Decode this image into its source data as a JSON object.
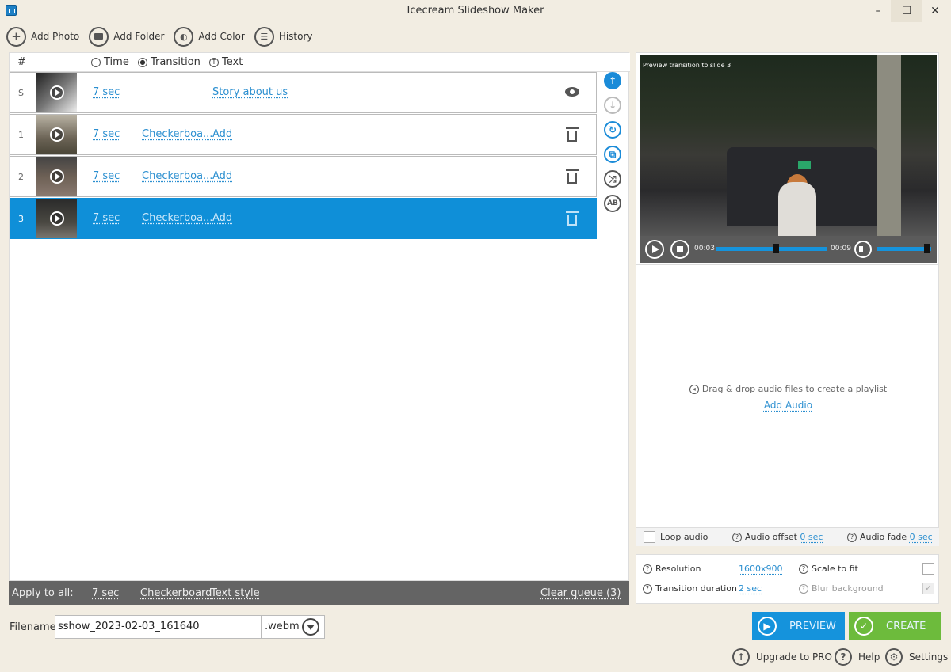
{
  "window": {
    "title": "Icecream Slideshow Maker",
    "minimize": "–",
    "maximize": "☐",
    "close": "✕"
  },
  "toolbar": {
    "add_photo": "Add Photo",
    "add_folder": "Add Folder",
    "add_color": "Add Color",
    "history": "History"
  },
  "list": {
    "headers": {
      "num": "#",
      "time": "Time",
      "transition": "Transition",
      "text": "Text"
    },
    "rows": [
      {
        "num": "S",
        "time": "7 sec",
        "transition": "",
        "text": "Story about us",
        "action_icon": "eye-icon",
        "selected": false
      },
      {
        "num": "1",
        "time": "7 sec",
        "transition": "Checkerboa...",
        "text": "Add",
        "action_icon": "trash-icon",
        "selected": false
      },
      {
        "num": "2",
        "time": "7 sec",
        "transition": "Checkerboa...",
        "text": "Add",
        "action_icon": "trash-icon",
        "selected": false
      },
      {
        "num": "3",
        "time": "7 sec",
        "transition": "Checkerboa...",
        "text": "Add",
        "action_icon": "trash-icon",
        "selected": true
      }
    ]
  },
  "side_actions": [
    "move-up-icon",
    "move-down-icon",
    "rotate-icon",
    "crop-icon",
    "shuffle-icon",
    "text-ab-icon"
  ],
  "apply_all": {
    "label": "Apply to all:",
    "time": "7 sec",
    "transition": "Checkerboard",
    "text_style": "Text style",
    "clear_queue": "Clear queue (3)"
  },
  "filename": {
    "label": "Filename:",
    "value": "sshow_2023-02-03_161640",
    "extension": ".webm"
  },
  "preview": {
    "caption": "Preview transition to slide 3",
    "current_time": "00:03",
    "total_time": "00:09",
    "progress": 0.54,
    "volume": 0.92
  },
  "audio": {
    "drop_text": "Drag & drop audio files to create a playlist",
    "add_audio": "Add Audio",
    "loop_label": "Loop audio",
    "loop_checked": false,
    "offset_label": "Audio offset",
    "offset_value": "0 sec",
    "fade_label": "Audio fade",
    "fade_value": "0 sec"
  },
  "settings": {
    "resolution_label": "Resolution",
    "resolution_value": "1600x900",
    "transition_label": "Transition duration",
    "transition_value": "2 sec",
    "scale_label": "Scale to fit",
    "scale_checked": false,
    "blur_label": "Blur background",
    "blur_checked": true
  },
  "actions": {
    "preview": "PREVIEW",
    "create": "CREATE"
  },
  "footer": {
    "upgrade": "Upgrade to PRO",
    "help": "Help",
    "settings": "Settings"
  },
  "colors": {
    "accent": "#0f8fd8",
    "create": "#6dbb3c",
    "link": "#2b8fd0"
  }
}
